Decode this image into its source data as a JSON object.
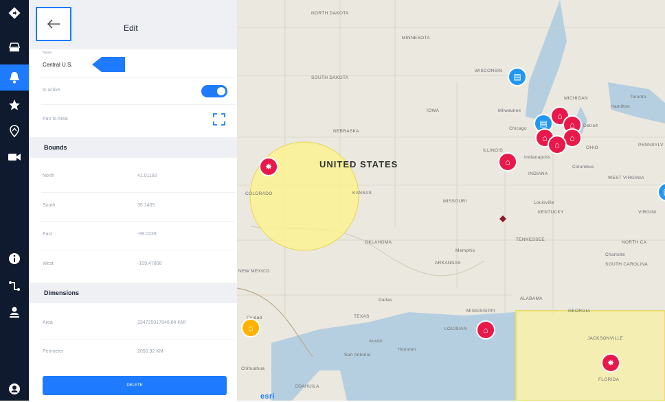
{
  "header": {
    "back_label": "←",
    "title": "Edit"
  },
  "form": {
    "name_caption": "Name",
    "name_value": "Central U.S.",
    "active_label": "Is active",
    "active_state": true,
    "pan_label": "Pan to Area"
  },
  "bounds": {
    "title": "Bounds",
    "rows": [
      {
        "label": "North",
        "value": "41.01192"
      },
      {
        "label": "South",
        "value": "35.1405"
      },
      {
        "label": "East",
        "value": "-99.0239"
      },
      {
        "label": "West",
        "value": "-109.47808"
      }
    ]
  },
  "dimensions": {
    "title": "Dimensions",
    "rows": [
      {
        "label": "Area",
        "value": "334725017846.64 KM²"
      },
      {
        "label": "Perimeter",
        "value": "2050.92 KM"
      }
    ]
  },
  "actions": {
    "delete_label": "DELETE"
  },
  "map": {
    "country": "UNITED STATES",
    "labels": {
      "north_dakota": "NORTH DAKOTA",
      "minnesota": "MINNESOTA",
      "south_dakota": "SOUTH DAKOTA",
      "wisconsin": "WISCONSIN",
      "michigan": "MICHIGAN",
      "toronto": "Toronto",
      "hamilton": "Hamilton",
      "iowa": "IOWA",
      "milwaukee": "Milwaukee",
      "chicago": "Chicago",
      "detroit": "Detroit",
      "nebraska": "NEBRASKA",
      "illinois": "ILLINOIS",
      "ohio": "OHIO",
      "pennsylvania": "PENNSYLV",
      "indianapolis": "Indianapolis",
      "columbus": "Columbus",
      "indiana": "INDIANA",
      "west_virginia": "WEST VIRGINIA",
      "colorado": "COLORADO",
      "kansas": "KANSAS",
      "missouri": "MISSOURI",
      "louisville": "Louisville",
      "kentucky": "KENTUCKY",
      "virginia": "VIRGINI",
      "tennessee": "TENNESSEE",
      "north_carolina": "NORTH CA",
      "oklahoma": "OKLAHOMA",
      "memphis": "Memphis",
      "arkansas": "ARKANSAS",
      "charlotte": "Charlotte",
      "south_carolina": "SOUTH CAROLINA",
      "new_mexico": "NEW MEXICO",
      "dallas": "Dallas",
      "alabama": "ALABAMA",
      "texas": "TEXAS",
      "mississippi": "MISSISSIPPI",
      "georgia": "GEORGIA",
      "louisiana": "LOUISIAN",
      "austin": "Austin",
      "houston": "Houston",
      "san_antonio": "San Antonio",
      "jacksonville": "JACKSONVILLE",
      "ciudad": "Ciudad",
      "chihuahua": "Chihuahua",
      "coahuila": "COAHUILA",
      "florida": "FLORIDA",
      "esri": "esri"
    }
  },
  "colors": {
    "accent": "#1e7bff",
    "rail": "#0f1a2e",
    "marker_red": "#e8194a",
    "marker_blue": "#2196f3",
    "marker_orange": "#ffb300",
    "circle_fill": "#fff48a",
    "rect_fill": "#fdf38e"
  }
}
